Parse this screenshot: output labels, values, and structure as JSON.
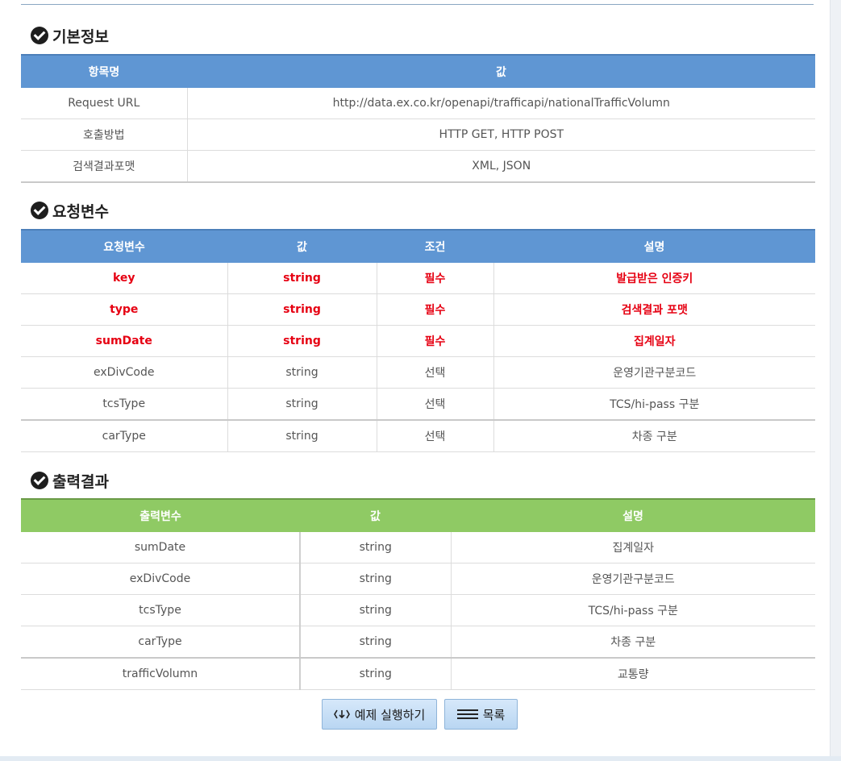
{
  "basic": {
    "title": "기본정보",
    "headers": [
      "항목명",
      "값"
    ],
    "rows": [
      [
        "Request URL",
        "http://data.ex.co.kr/openapi/trafficapi/nationalTrafficVolumn"
      ],
      [
        "호출방법",
        "HTTP GET, HTTP POST"
      ],
      [
        "검색결과포맷",
        "XML, JSON"
      ]
    ]
  },
  "request": {
    "title": "요청변수",
    "headers": [
      "요청변수",
      "값",
      "조건",
      "설명"
    ],
    "rows": [
      [
        "key",
        "string",
        "필수",
        "발급받은 인증키"
      ],
      [
        "type",
        "string",
        "필수",
        "검색결과 포맷"
      ],
      [
        "sumDate",
        "string",
        "필수",
        "집계일자"
      ],
      [
        "exDivCode",
        "string",
        "선택",
        "운영기관구분코드"
      ],
      [
        "tcsType",
        "string",
        "선택",
        "TCS/hi-pass 구분"
      ],
      [
        "carType",
        "string",
        "선택",
        "차종 구분"
      ]
    ]
  },
  "output": {
    "title": "출력결과",
    "headers": [
      "출력변수",
      "값",
      "설명"
    ],
    "rows": [
      [
        "sumDate",
        "string",
        "집계일자"
      ],
      [
        "exDivCode",
        "string",
        "운영기관구분코드"
      ],
      [
        "tcsType",
        "string",
        "TCS/hi-pass 구분"
      ],
      [
        "carType",
        "string",
        "차종 구분"
      ],
      [
        "trafficVolumn",
        "string",
        "교통량"
      ]
    ]
  },
  "buttons": {
    "run_example": "예제 실행하기",
    "list": "목록"
  },
  "colors": {
    "blue_header": "#5f96d3",
    "green_header": "#8fca64",
    "required_text": "#e60012"
  }
}
